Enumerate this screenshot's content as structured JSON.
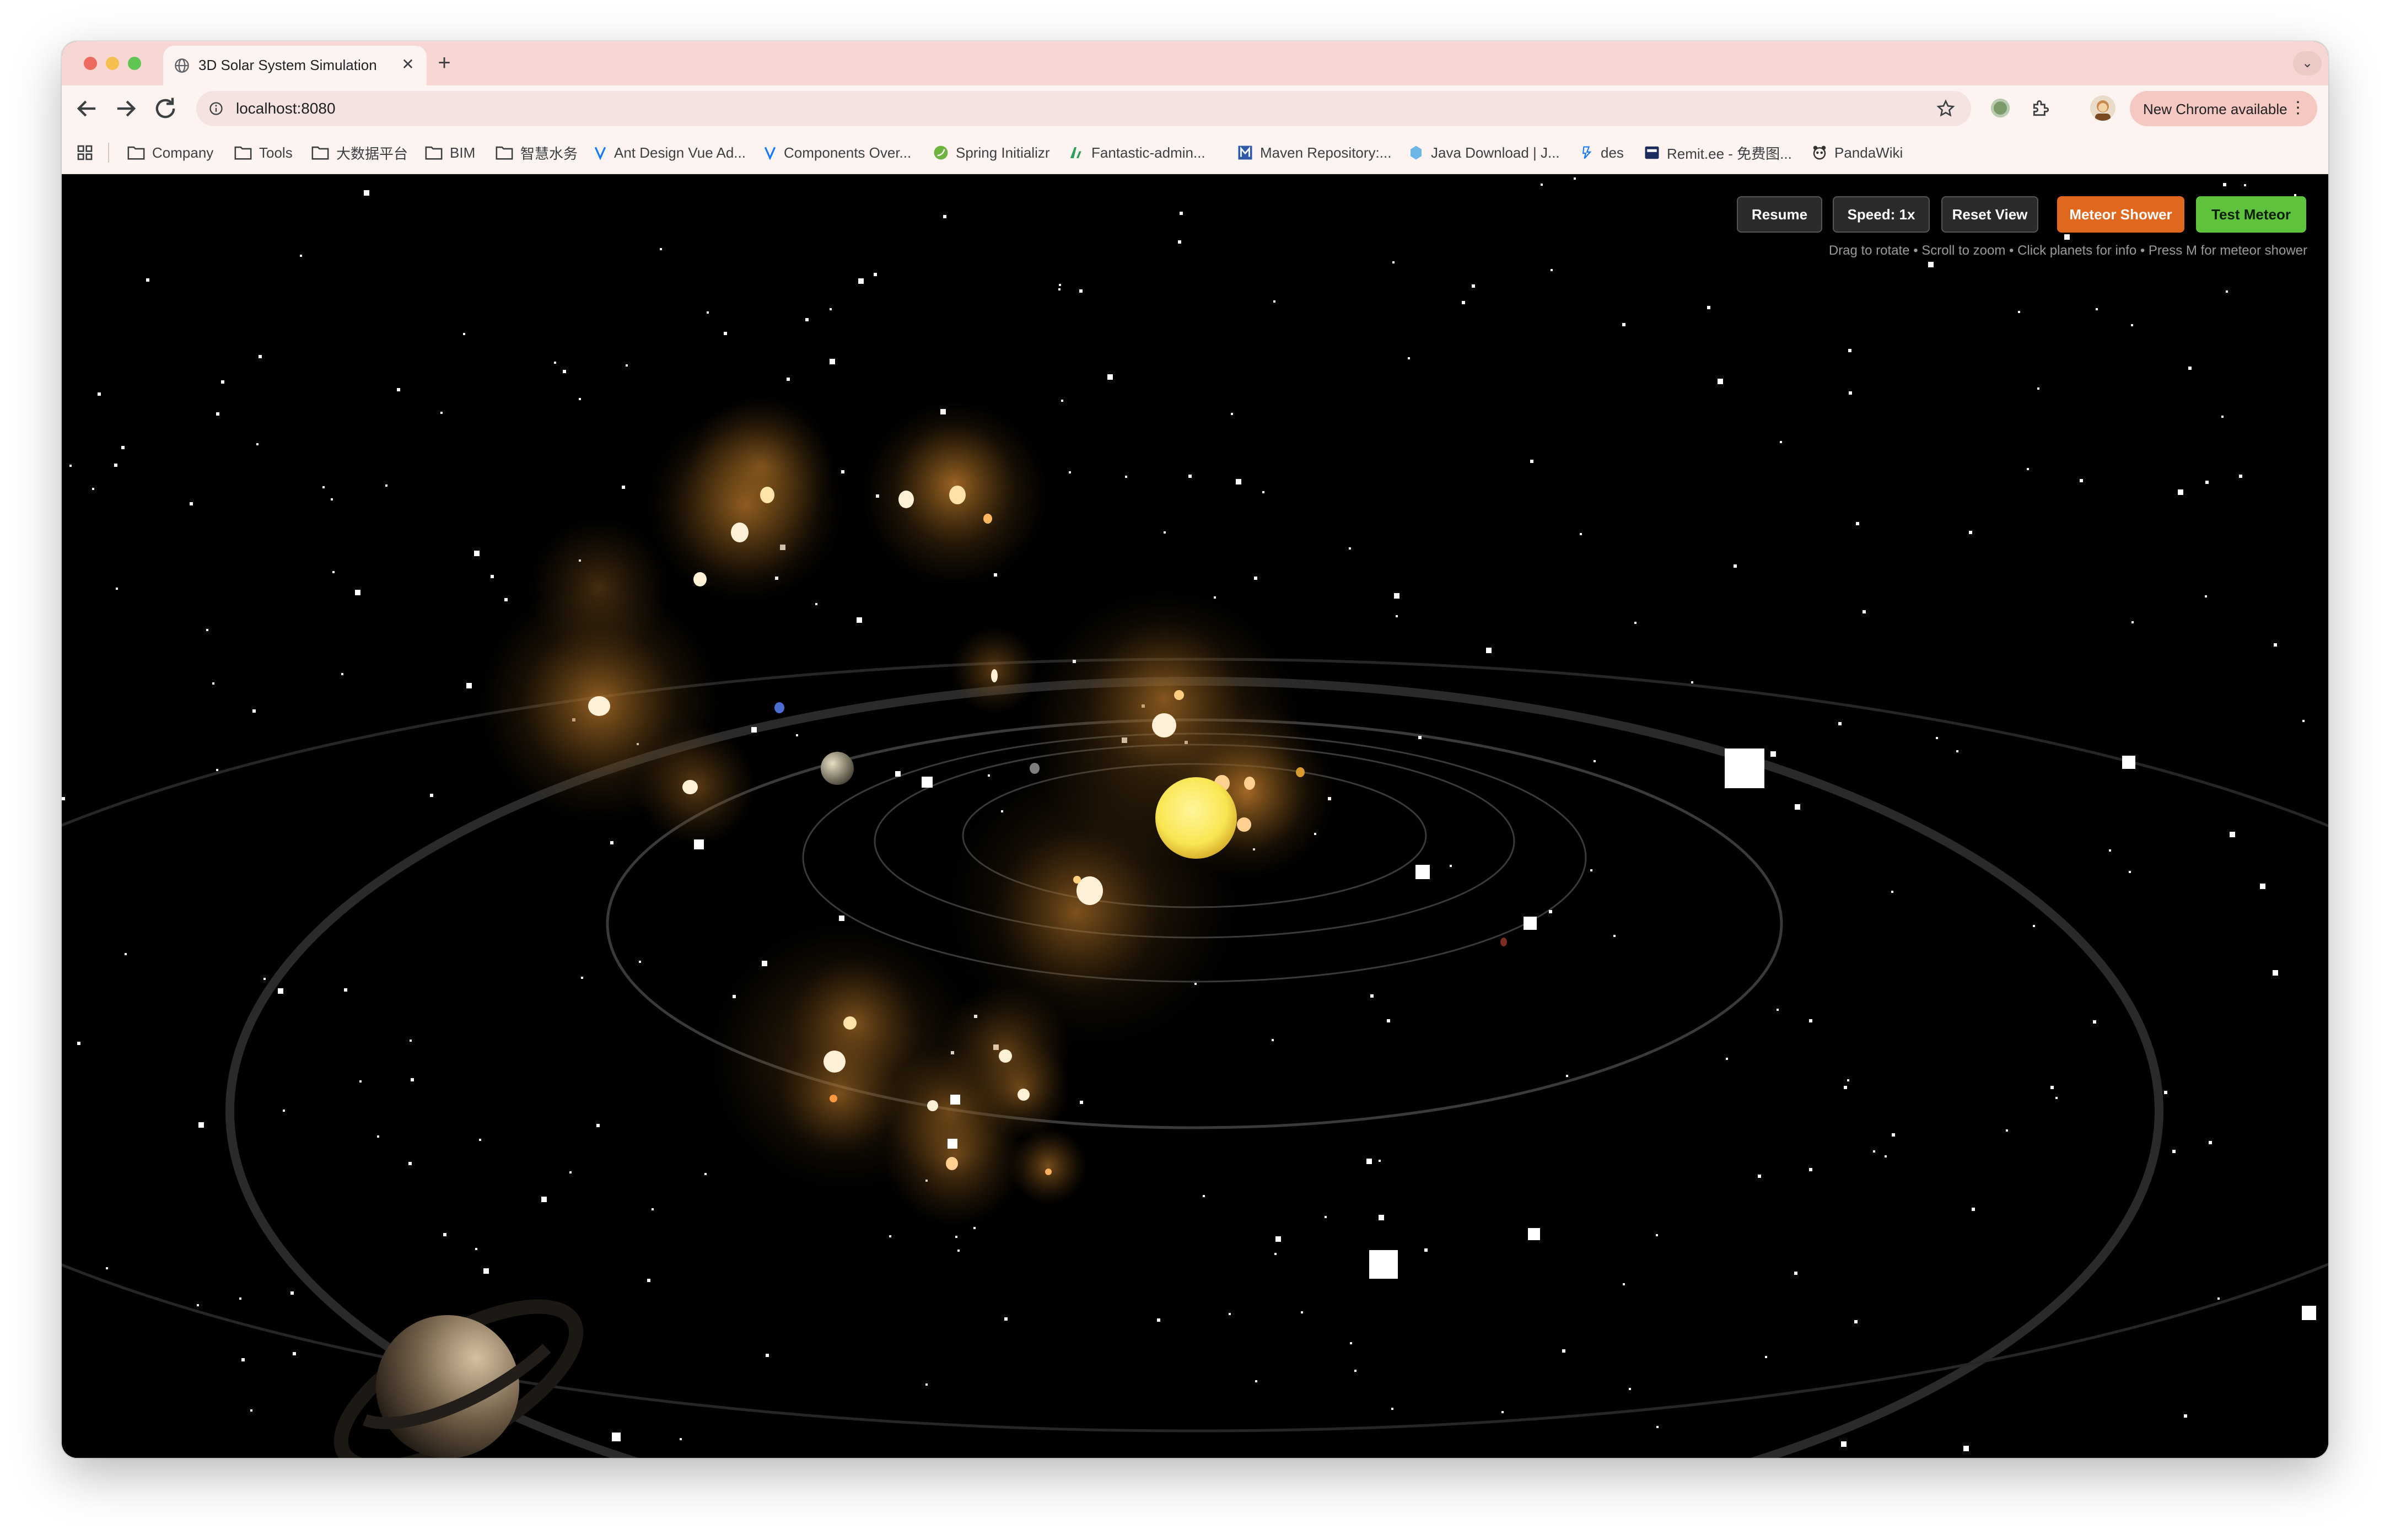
{
  "browser": {
    "tab_title": "3D Solar System Simulation",
    "url": "localhost:8080",
    "update_label": "New Chrome available",
    "bookmarks": [
      {
        "label": "Company",
        "icon": "folder-icon"
      },
      {
        "label": "Tools",
        "icon": "folder-icon"
      },
      {
        "label": "大数据平台",
        "icon": "folder-icon"
      },
      {
        "label": "BIM",
        "icon": "folder-icon"
      },
      {
        "label": "智慧水务",
        "icon": "folder-icon"
      },
      {
        "label": "Ant Design Vue Ad...",
        "icon": "ant-design-icon"
      },
      {
        "label": "Components Over...",
        "icon": "ant-design-icon"
      },
      {
        "label": "Spring Initializr",
        "icon": "spring-icon"
      },
      {
        "label": "Fantastic-admin...",
        "icon": "fantastic-admin-icon"
      },
      {
        "label": "Maven Repository:...",
        "icon": "maven-icon"
      },
      {
        "label": "Java Download | J...",
        "icon": "java-icon"
      },
      {
        "label": "des",
        "icon": "des-icon"
      },
      {
        "label": "Remit.ee - 免费图...",
        "icon": "remit-icon"
      },
      {
        "label": "PandaWiki",
        "icon": "pandawiki-icon"
      }
    ]
  },
  "controls": {
    "resume": "Resume",
    "speed": "Speed: 1x",
    "reset_view": "Reset View",
    "meteor_shower": "Meteor Shower",
    "test_meteor": "Test Meteor",
    "hint": "Drag to rotate • Scroll to zoom • Click planets for info • Press M for meteor shower"
  },
  "colors": {
    "sun": "#f9e652",
    "orbit": "#3a3a3a",
    "meteor_glow": "#8a5a1c",
    "meteor_core": "#fff1d8",
    "meteor_button": "#e0671e",
    "test_button": "#5ec23c",
    "tab_strip": "#f6d7d3"
  }
}
